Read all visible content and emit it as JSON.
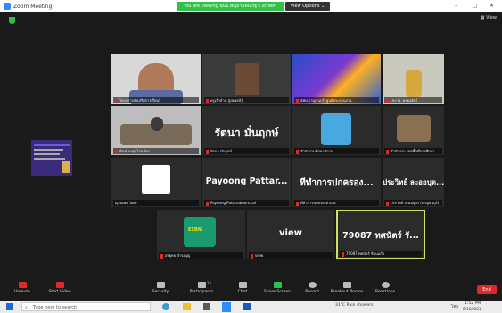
{
  "window": {
    "title": "Zoom Meeting",
    "minimize": "–",
    "maximize": "▢",
    "close": "✕"
  },
  "banner": {
    "text": "You are viewing ฉบบ.หญ่ถามคณรัฐ's screen"
  },
  "view_options": {
    "label": "View Options ⌄"
  },
  "gallery_view": {
    "label": "View"
  },
  "share_thumb": {
    "caption": ""
  },
  "tiles": [
    {
      "name": "โครงการส่งเสริมการเรียนรู้",
      "big": ""
    },
    {
      "name": "ครูเจ้าบ้าน (paweit)",
      "big": ""
    },
    {
      "name": "สพป.กาญจนบุรี_ศูนย์ประสานงาน",
      "big": ""
    },
    {
      "name": "ประวร. ครองสังข์",
      "big": ""
    },
    {
      "name": "ห้องประชุมโรงเรียน",
      "big": ""
    },
    {
      "name": "รัตนา มั่นฤกษ์",
      "big": "รัตนา มั่นฤกษ์"
    },
    {
      "name": "สำนักงานศึกษาธิการ",
      "big": ""
    },
    {
      "name": "สำนักงาน เขตพื้นที่การศึกษา",
      "big": ""
    },
    {
      "name": "ญาณพล วิเศษ",
      "big": ""
    },
    {
      "name": "Payoong Pattaraboonchai",
      "big": "Payoong Pattar..."
    },
    {
      "name": "ที่ทำการปกครองอำเภอ",
      "big": "ที่ทำการปกครอง..."
    },
    {
      "name": "ประวิทย์ ละออบุตร (กาญจนบุรี)",
      "big": "ประวิทย์ ละออบุต..."
    },
    {
      "name": "สรยุทธ ดำรงบุญ",
      "big": ""
    },
    {
      "name": "view",
      "big": "view"
    },
    {
      "name": "79087 ทศนัตร์ ซ้อนแก้ว",
      "big": "79087 ทศนัตร์ รั..."
    }
  ],
  "toolbar": {
    "unmute": "Unmute",
    "start_video": "Start Video",
    "security": "Security",
    "participants": "Participants",
    "participants_count": "15",
    "chat": "Chat",
    "share": "Share Screen",
    "record": "Record",
    "breakout": "Breakout Rooms",
    "reactions": "Reactions",
    "end": "End"
  },
  "taskbar": {
    "search": "Type here to search",
    "weather": "31°C  Rain showers",
    "lang": "ไทย",
    "time": "1:52 PM",
    "date": "8/16/2021"
  },
  "colors": {
    "accent": "#2ec24a",
    "end": "#e02828",
    "active_border": "#c9e265"
  }
}
